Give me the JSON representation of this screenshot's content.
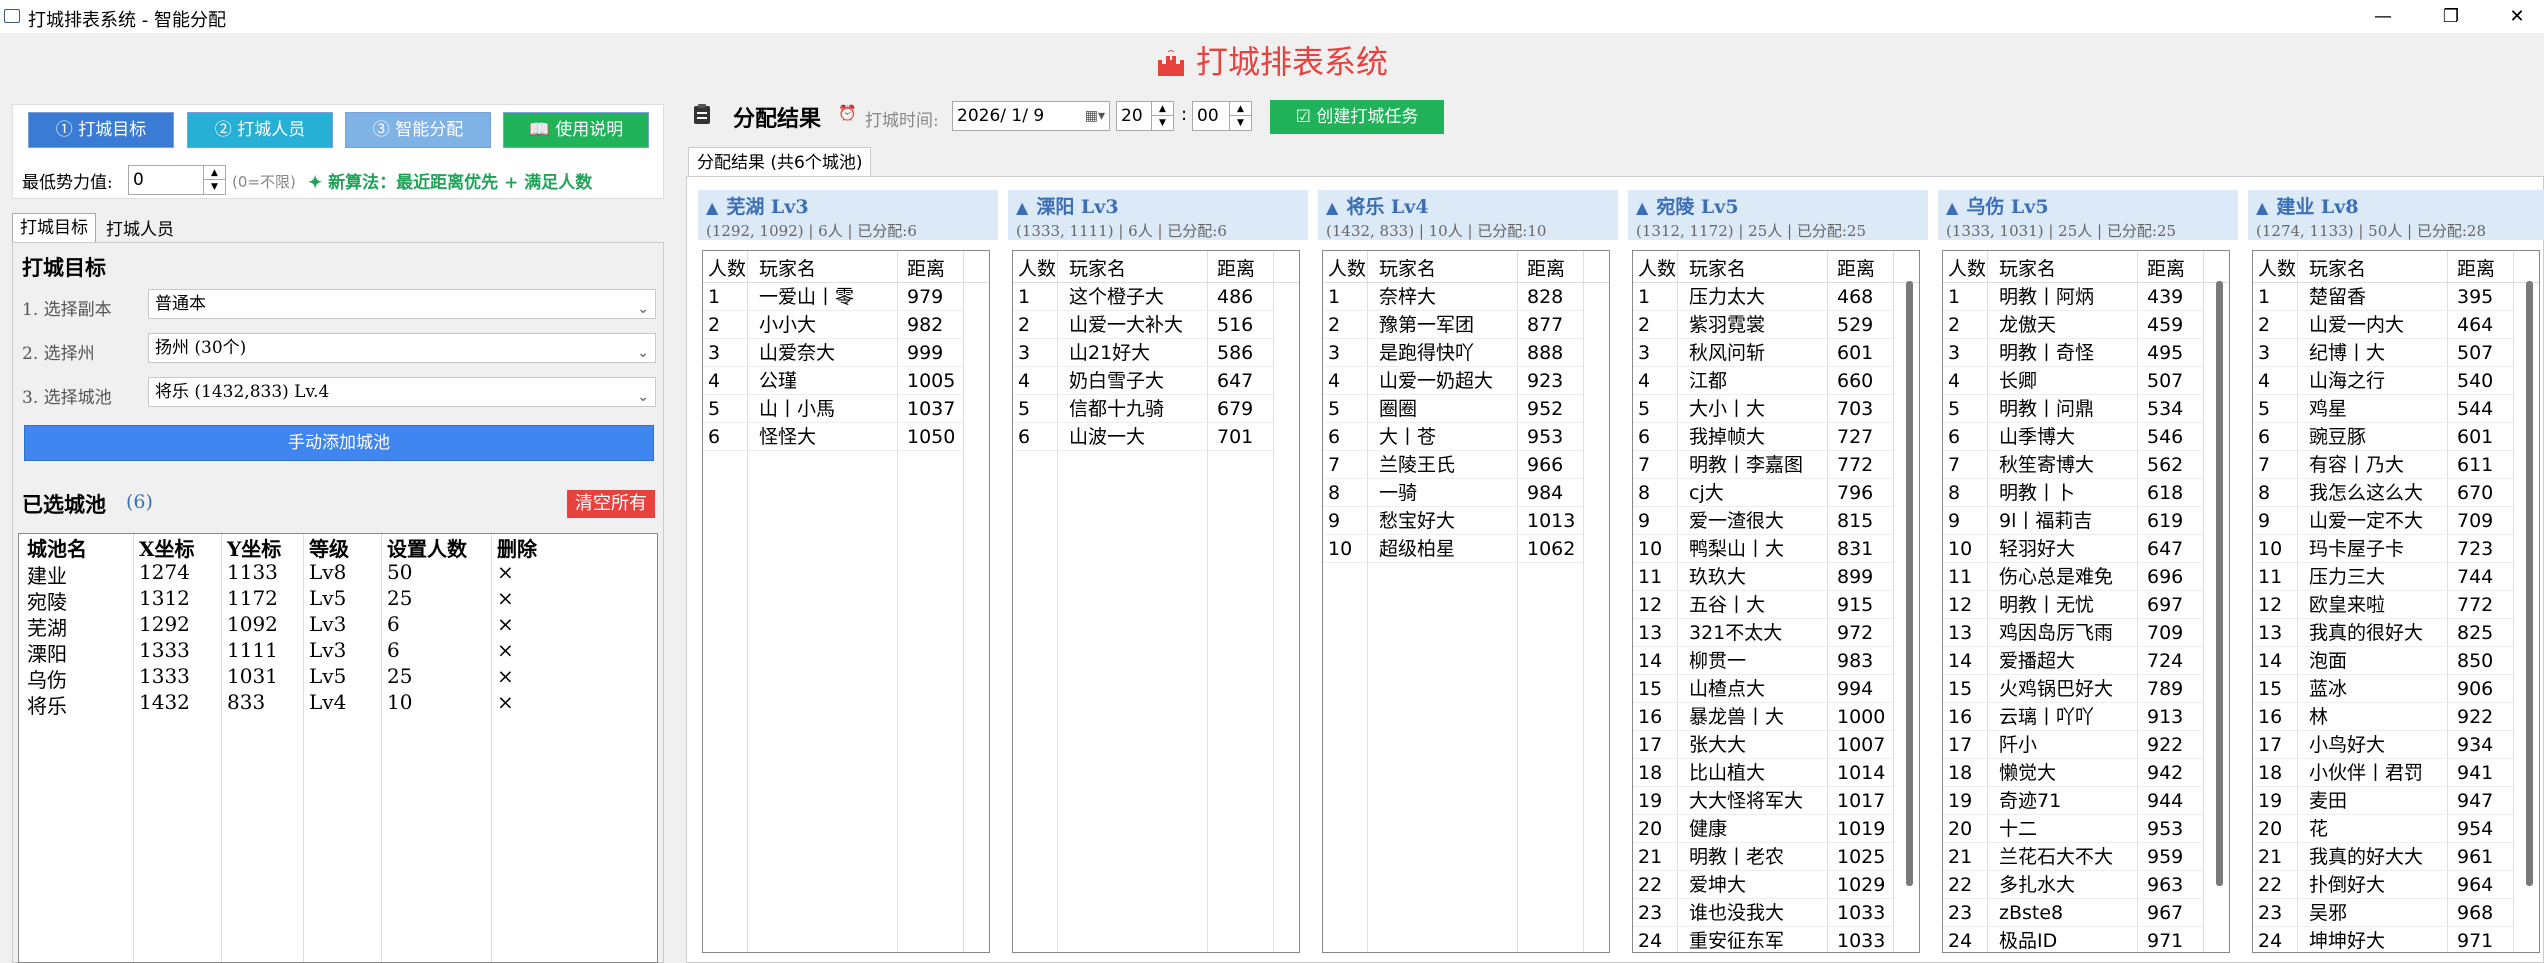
{
  "window": {
    "title": "打城排表系统 - 智能分配",
    "minimize": "—",
    "maximize": "❐",
    "close": "✕"
  },
  "app_title": "打城排表系统",
  "nav": [
    {
      "label": "① 打城目标",
      "bg": "#3a7bd5"
    },
    {
      "label": "② 打城人员",
      "bg": "#26b0d5"
    },
    {
      "label": "③ 智能分配",
      "bg": "#7fb2e5"
    },
    {
      "label": "📖 使用说明",
      "bg": "#21b35a"
    }
  ],
  "min_power": {
    "label": "最低势力值:",
    "value": "0",
    "hint": "(0=不限)"
  },
  "algo_note": "新算法：最近距离优先 + 满足人数",
  "left_tabs": [
    "打城目标",
    "打城人员"
  ],
  "section_title": "打城目标",
  "form": [
    {
      "label": "1. 选择副本",
      "value": "普通本"
    },
    {
      "label": "2. 选择州",
      "value": "扬州 (30个)"
    },
    {
      "label": "3. 选择城池",
      "value": "将乐 (1432,833) Lv.4"
    }
  ],
  "add_city_button": "手动添加城池",
  "selected": {
    "label": "已选城池",
    "count": "(6)",
    "clear": "清空所有"
  },
  "city_table": {
    "headers": [
      "城池名",
      "X坐标",
      "Y坐标",
      "等级",
      "设置人数",
      "删除"
    ],
    "rows": [
      [
        "建业",
        "1274",
        "1133",
        "Lv8",
        "50",
        "×"
      ],
      [
        "宛陵",
        "1312",
        "1172",
        "Lv5",
        "25",
        "×"
      ],
      [
        "芜湖",
        "1292",
        "1092",
        "Lv3",
        "6",
        "×"
      ],
      [
        "溧阳",
        "1333",
        "1111",
        "Lv3",
        "6",
        "×"
      ],
      [
        "乌伤",
        "1333",
        "1031",
        "Lv5",
        "25",
        "×"
      ],
      [
        "将乐",
        "1432",
        "833",
        "Lv4",
        "10",
        "×"
      ]
    ]
  },
  "result": {
    "title": "分配结果",
    "time_label": "打城时间:",
    "date": "2026/ 1/ 9",
    "hour": "20",
    "minute": "00",
    "create_button": "创建打城任务",
    "tab": "分配结果 (共6个城池)",
    "col_headers": [
      "人数",
      "玩家名",
      "距离"
    ]
  },
  "cards": [
    {
      "title": "芜湖 Lv3",
      "sub": "(1292, 1092) | 6人 | 已分配:6",
      "rows": [
        [
          "1",
          "一爱山丨零",
          "979"
        ],
        [
          "2",
          "小小大",
          "982"
        ],
        [
          "3",
          "山爱奈大",
          "999"
        ],
        [
          "4",
          "公瑾",
          "1005"
        ],
        [
          "5",
          "山丨小馬",
          "1037"
        ],
        [
          "6",
          "怪怪大",
          "1050"
        ]
      ]
    },
    {
      "title": "溧阳 Lv3",
      "sub": "(1333, 1111) | 6人 | 已分配:6",
      "rows": [
        [
          "1",
          "这个橙子大",
          "486"
        ],
        [
          "2",
          "山爱一大补大",
          "516"
        ],
        [
          "3",
          "山21好大",
          "586"
        ],
        [
          "4",
          "奶白雪子大",
          "647"
        ],
        [
          "5",
          "信都十九骑",
          "679"
        ],
        [
          "6",
          "山波一大",
          "701"
        ]
      ]
    },
    {
      "title": "将乐 Lv4",
      "sub": "(1432, 833) | 10人 | 已分配:10",
      "rows": [
        [
          "1",
          "奈梓大",
          "828"
        ],
        [
          "2",
          "豫第一军团",
          "877"
        ],
        [
          "3",
          "是跑得快吖",
          "888"
        ],
        [
          "4",
          "山爱一奶超大",
          "923"
        ],
        [
          "5",
          "圈圈",
          "952"
        ],
        [
          "6",
          "大丨苍",
          "953"
        ],
        [
          "7",
          "兰陵王氏",
          "966"
        ],
        [
          "8",
          "一骑",
          "984"
        ],
        [
          "9",
          "愁宝好大",
          "1013"
        ],
        [
          "10",
          "超级柏星",
          "1062"
        ]
      ]
    },
    {
      "title": "宛陵 Lv5",
      "sub": "(1312, 1172) | 25人 | 已分配:25",
      "rows": [
        [
          "1",
          "压力太大",
          "468"
        ],
        [
          "2",
          "紫羽霓裳",
          "529"
        ],
        [
          "3",
          "秋风问斩",
          "601"
        ],
        [
          "4",
          "江都",
          "660"
        ],
        [
          "5",
          "大小丨大",
          "703"
        ],
        [
          "6",
          "我掉帧大",
          "727"
        ],
        [
          "7",
          "明教丨李嘉图",
          "772"
        ],
        [
          "8",
          "cj大",
          "796"
        ],
        [
          "9",
          "爱一渣很大",
          "815"
        ],
        [
          "10",
          "鸭梨山丨大",
          "831"
        ],
        [
          "11",
          "玖玖大",
          "899"
        ],
        [
          "12",
          "五谷丨大",
          "915"
        ],
        [
          "13",
          "321不太大",
          "972"
        ],
        [
          "14",
          "柳贯一",
          "983"
        ],
        [
          "15",
          "山楂点大",
          "994"
        ],
        [
          "16",
          "暴龙兽丨大",
          "1000"
        ],
        [
          "17",
          "张大大",
          "1007"
        ],
        [
          "18",
          "比山植大",
          "1014"
        ],
        [
          "19",
          "大大怪将军大",
          "1017"
        ],
        [
          "20",
          "健康",
          "1019"
        ],
        [
          "21",
          "明教丨老农",
          "1025"
        ],
        [
          "22",
          "爱坤大",
          "1029"
        ],
        [
          "23",
          "谁也没我大",
          "1033"
        ],
        [
          "24",
          "重安征东军",
          "1033"
        ]
      ]
    },
    {
      "title": "乌伤 Lv5",
      "sub": "(1333, 1031) | 25人 | 已分配:25",
      "rows": [
        [
          "1",
          "明教丨阿炳",
          "439"
        ],
        [
          "2",
          "龙傲天",
          "459"
        ],
        [
          "3",
          "明教丨奇怪",
          "495"
        ],
        [
          "4",
          "长卿",
          "507"
        ],
        [
          "5",
          "明教丨问鼎",
          "534"
        ],
        [
          "6",
          "山季博大",
          "546"
        ],
        [
          "7",
          "秋笙寄博大",
          "562"
        ],
        [
          "8",
          "明教丨卜",
          "618"
        ],
        [
          "9",
          "9l丨福莉吉",
          "619"
        ],
        [
          "10",
          "轻羽好大",
          "647"
        ],
        [
          "11",
          "伤心总是难免",
          "696"
        ],
        [
          "12",
          "明教丨无忧",
          "697"
        ],
        [
          "13",
          "鸡因岛厉飞雨",
          "709"
        ],
        [
          "14",
          "爱播超大",
          "724"
        ],
        [
          "15",
          "火鸡锅巴好大",
          "789"
        ],
        [
          "16",
          "云璃丨吖吖",
          "913"
        ],
        [
          "17",
          "阡小",
          "922"
        ],
        [
          "18",
          "懒觉大",
          "942"
        ],
        [
          "19",
          "奇迹71",
          "944"
        ],
        [
          "20",
          "十二",
          "953"
        ],
        [
          "21",
          "兰花石大不大",
          "959"
        ],
        [
          "22",
          "多扎水大",
          "963"
        ],
        [
          "23",
          "zBste8",
          "967"
        ],
        [
          "24",
          "极品ID",
          "971"
        ]
      ]
    },
    {
      "title": "建业 Lv8",
      "sub": "(1274, 1133) | 50人 | 已分配:28",
      "rows": [
        [
          "1",
          "楚留香",
          "395"
        ],
        [
          "2",
          "山爱一内大",
          "464"
        ],
        [
          "3",
          "纪博丨大",
          "507"
        ],
        [
          "4",
          "山海之行",
          "540"
        ],
        [
          "5",
          "鸡星",
          "544"
        ],
        [
          "6",
          "豌豆豚",
          "601"
        ],
        [
          "7",
          "有容丨乃大",
          "611"
        ],
        [
          "8",
          "我怎么这么大",
          "670"
        ],
        [
          "9",
          "山爱一定不大",
          "709"
        ],
        [
          "10",
          "玛卡屋子卡",
          "723"
        ],
        [
          "11",
          "压力三大",
          "744"
        ],
        [
          "12",
          "欧皇来啦",
          "772"
        ],
        [
          "13",
          "我真的很好大",
          "825"
        ],
        [
          "14",
          "泡面",
          "850"
        ],
        [
          "15",
          "蓝冰",
          "906"
        ],
        [
          "16",
          "林",
          "922"
        ],
        [
          "17",
          "小鸟好大",
          "934"
        ],
        [
          "18",
          "小伙伴丨君罚",
          "941"
        ],
        [
          "19",
          "麦田",
          "947"
        ],
        [
          "20",
          "花",
          "954"
        ],
        [
          "21",
          "我真的好大大",
          "961"
        ],
        [
          "22",
          "扑倒好大",
          "964"
        ],
        [
          "23",
          "吴邪",
          "968"
        ],
        [
          "24",
          "坤坤好大",
          "971"
        ]
      ]
    }
  ]
}
